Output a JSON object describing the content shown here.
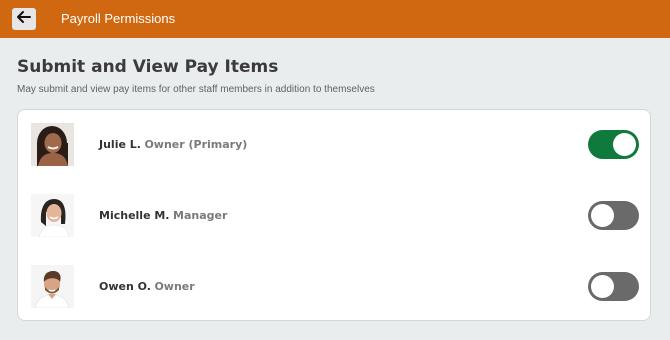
{
  "header": {
    "back_icon": "arrow-left-icon",
    "title": "Payroll Permissions",
    "bar_color": "#d06812"
  },
  "section": {
    "title": "Submit and View Pay Items",
    "description": "May submit and view pay items for other staff members in addition to themselves"
  },
  "members": [
    {
      "name": "Julie L.",
      "role": "Owner (Primary)",
      "enabled": true
    },
    {
      "name": "Michelle M.",
      "role": "Manager",
      "enabled": false
    },
    {
      "name": "Owen O.",
      "role": "Owner",
      "enabled": false
    }
  ],
  "colors": {
    "toggle_on": "#0f7a3b",
    "toggle_off": "#6a6a6a"
  }
}
